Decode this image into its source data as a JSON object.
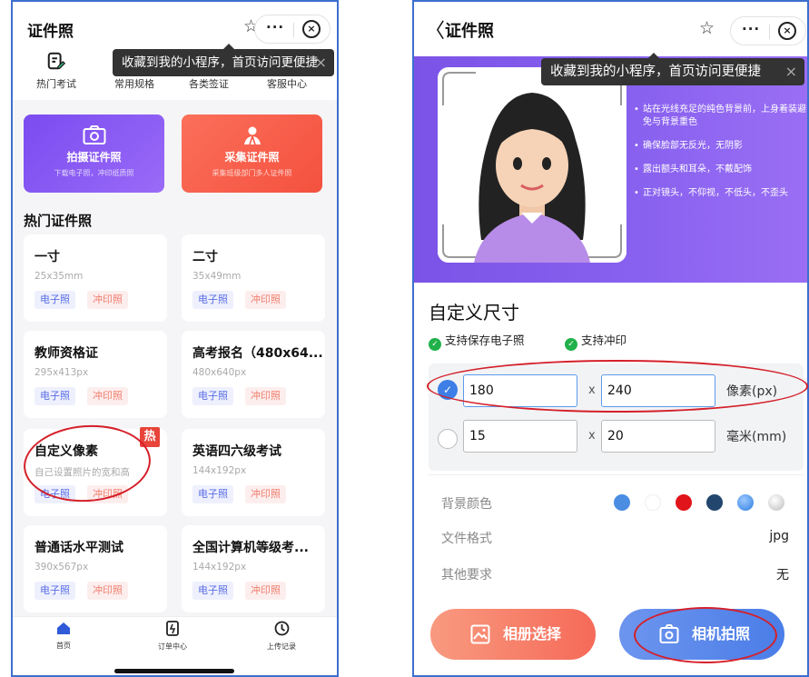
{
  "left": {
    "title": "证件照",
    "tooltip": "收藏到我的小程序，首页访问更便捷",
    "tooltip_close": "×",
    "quick_items": [
      {
        "label": "热门考试",
        "icon": "exam-doc-icon"
      },
      {
        "label": "常用规格",
        "icon": "spec-icon"
      },
      {
        "label": "各类签证",
        "icon": "passport-icon"
      },
      {
        "label": "客服中心",
        "icon": "service-icon"
      }
    ],
    "cards": [
      {
        "title": "拍摄证件照",
        "subtitle": "下载电子照，冲印纸质照",
        "icon": "camera-icon"
      },
      {
        "title": "采集证件照",
        "subtitle": "采集班级部门多人证件照",
        "icon": "group-icon"
      }
    ],
    "section_title": "热门证件照",
    "tag_electronic": "电子照",
    "tag_print": "冲印照",
    "hot_badge": "热",
    "photos": [
      {
        "name": "一寸",
        "size": "25x35mm"
      },
      {
        "name": "二寸",
        "size": "35x49mm"
      },
      {
        "name": "教师资格证",
        "size": "295x413px"
      },
      {
        "name": "高考报名（480x64...",
        "size": "480x640px"
      },
      {
        "name": "自定义像素",
        "size": "自己设置照片的宽和高"
      },
      {
        "name": "英语四六级考试",
        "size": "144x192px"
      },
      {
        "name": "普通话水平测试",
        "size": "390x567px"
      },
      {
        "name": "全国计算机等级考...",
        "size": "144x192px"
      }
    ],
    "tabs": [
      {
        "label": "首页",
        "icon": "home-icon"
      },
      {
        "label": "订单中心",
        "icon": "order-icon"
      },
      {
        "label": "上传记录",
        "icon": "history-icon"
      }
    ]
  },
  "right": {
    "back": "〈",
    "title": "证件照",
    "tooltip": "收藏到我的小程序，首页访问更便捷",
    "tips": [
      "站在光线充足的纯色背景前，上身着装避免与背景重色",
      "确保脸部无反光，无阴影",
      "露出额头和耳朵，不戴配饰",
      "正对镜头，不仰视，不低头，不歪头"
    ],
    "size_title": "自定义尺寸",
    "support": [
      "支持保存电子照",
      "支持冲印"
    ],
    "pixel": {
      "width": "180",
      "height": "240",
      "unit": "像素(px)",
      "selected": true
    },
    "mm": {
      "width": "15",
      "height": "20",
      "unit": "毫米(mm)",
      "selected": false
    },
    "times": "x",
    "settings": [
      {
        "label": "背景颜色",
        "value": ""
      },
      {
        "label": "文件格式",
        "value": "jpg"
      },
      {
        "label": "其他要求",
        "value": "无"
      }
    ],
    "bg_colors": [
      "#4a8de3",
      "#ffffff",
      "#e0141a",
      "#22466e",
      "#2f7ee0",
      "#c8c8c8"
    ],
    "btn_album": "相册选择",
    "btn_camera": "相机拍照"
  },
  "nav": {
    "star": "☆",
    "more": "···",
    "close": "⊗"
  }
}
